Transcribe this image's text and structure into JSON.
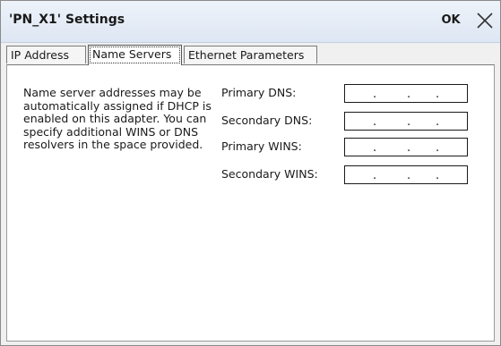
{
  "window": {
    "title": "'PN_X1' Settings",
    "ok_label": "OK"
  },
  "tabs": [
    {
      "label": "IP Address",
      "selected": false
    },
    {
      "label": "Name Servers",
      "selected": true
    },
    {
      "label": "Ethernet Parameters",
      "selected": false
    }
  ],
  "name_servers": {
    "description": "Name server addresses may be automatically assigned if DHCP is enabled on this adapter. You can specify additional WINS or DNS resolvers in the space provided.",
    "fields": [
      {
        "label": "Primary DNS:",
        "value": ""
      },
      {
        "label": "Secondary DNS:",
        "value": ""
      },
      {
        "label": "Primary WINS:",
        "value": ""
      },
      {
        "label": "Secondary WINS:",
        "value": ""
      }
    ]
  },
  "icons": {
    "close": "close-icon"
  }
}
